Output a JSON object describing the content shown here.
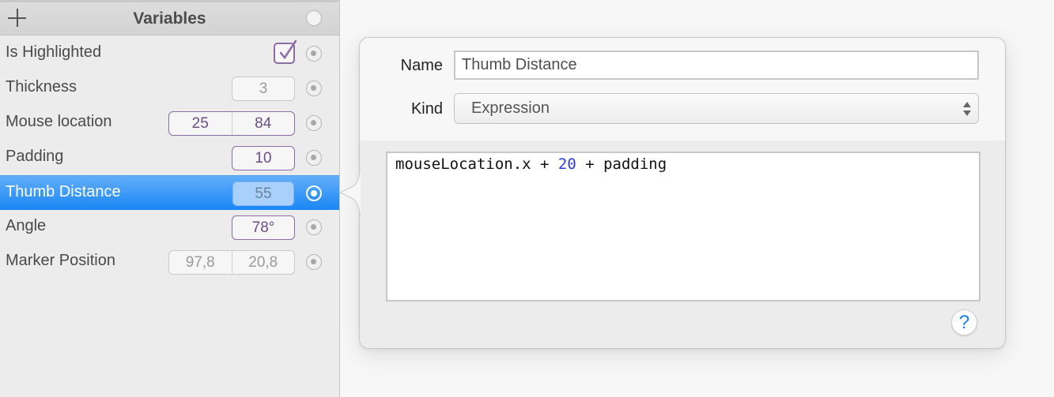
{
  "sidebar": {
    "title": "Variables",
    "add_icon": "plus-icon",
    "rows": [
      {
        "label": "Is Highlighted",
        "type": "checkbox",
        "checked": true
      },
      {
        "label": "Thickness",
        "type": "number",
        "value": "3"
      },
      {
        "label": "Mouse location",
        "type": "point",
        "values": [
          "25",
          "84"
        ]
      },
      {
        "label": "Padding",
        "type": "number",
        "value": "10"
      },
      {
        "label": "Thumb Distance",
        "type": "number",
        "value": "55",
        "selected": true
      },
      {
        "label": "Angle",
        "type": "number",
        "value": "78°"
      },
      {
        "label": "Marker Position",
        "type": "point",
        "values": [
          "97,8",
          "20,8"
        ]
      }
    ]
  },
  "popover": {
    "name_label": "Name",
    "name_value": "Thumb Distance",
    "kind_label": "Kind",
    "kind_value": "Expression",
    "expression": {
      "part1": "mouseLocation.x + ",
      "number": "20",
      "part2": " + padding"
    },
    "help_label": "?"
  },
  "colors": {
    "accent": "#1a86f4",
    "linked_field": "#8d6ca6",
    "number_literal": "#2b3cdc"
  }
}
